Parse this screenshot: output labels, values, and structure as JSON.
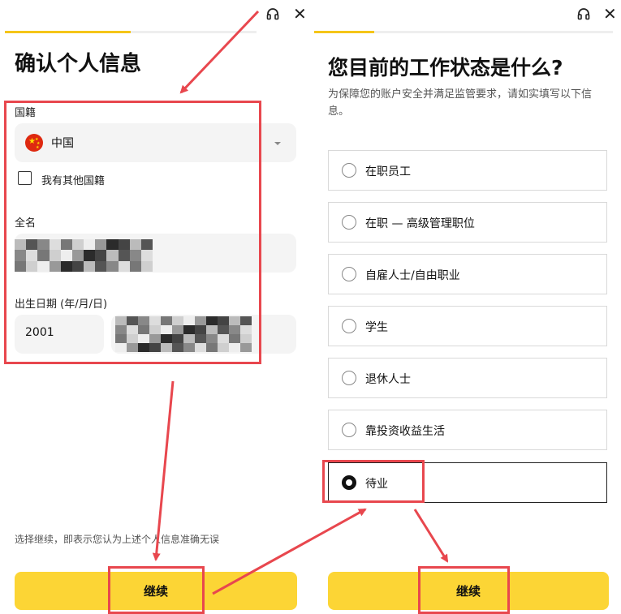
{
  "left": {
    "title": "确认个人信息",
    "nationality_label": "国籍",
    "nationality_value": "中国",
    "other_nationality_label": "我有其他国籍",
    "fullname_label": "全名",
    "dob_label": "出生日期 (年/月/日)",
    "dob_year": "2001",
    "footnote": "选择继续，即表示您认为上述个人信息准确无误",
    "continue_label": "继续",
    "progress": 0.5
  },
  "right": {
    "title": "您目前的工作状态是什么?",
    "subtitle": "为保障您的账户安全并满足监管要求，请如实填写以下信息。",
    "options": [
      {
        "label": "在职员工",
        "selected": false
      },
      {
        "label": "在职 — 高级管理职位",
        "selected": false
      },
      {
        "label": "自雇人士/自由职业",
        "selected": false
      },
      {
        "label": "学生",
        "selected": false
      },
      {
        "label": "退休人士",
        "selected": false
      },
      {
        "label": "靠投资收益生活",
        "selected": false
      },
      {
        "label": "待业",
        "selected": true
      }
    ],
    "continue_label": "继续",
    "progress": 0.2
  },
  "icons": {
    "support": "headset-icon",
    "close": "close-icon",
    "dropdown": "caret-down-icon",
    "flag": "china-flag-icon"
  },
  "colors": {
    "accent": "#fcd535",
    "highlight": "#e8474e"
  },
  "close_glyph": "✕"
}
